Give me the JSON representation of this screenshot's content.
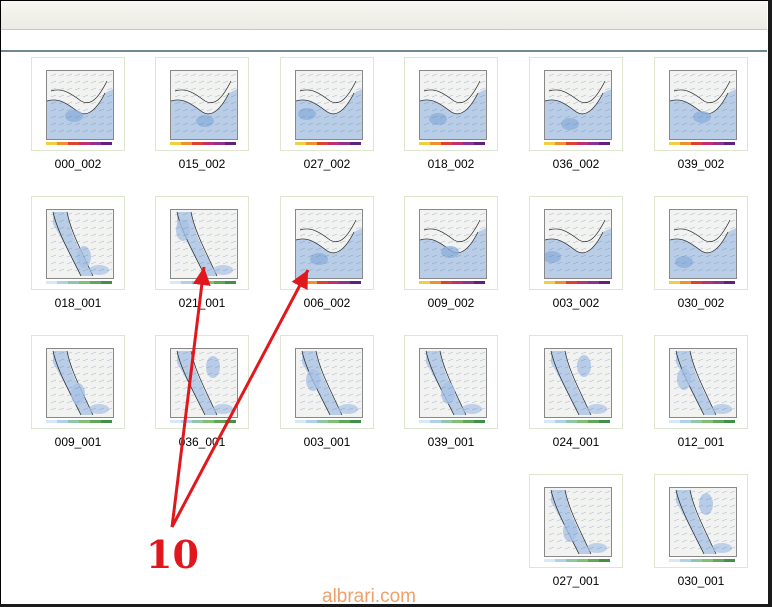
{
  "files": [
    {
      "name": "000_002",
      "kind": "gulf"
    },
    {
      "name": "015_002",
      "kind": "gulf"
    },
    {
      "name": "027_002",
      "kind": "gulf"
    },
    {
      "name": "018_002",
      "kind": "gulf"
    },
    {
      "name": "036_002",
      "kind": "gulf"
    },
    {
      "name": "039_002",
      "kind": "gulf"
    },
    {
      "name": "018_001",
      "kind": "redsea"
    },
    {
      "name": "021_001",
      "kind": "redsea"
    },
    {
      "name": "006_002",
      "kind": "gulf"
    },
    {
      "name": "009_002",
      "kind": "gulf"
    },
    {
      "name": "003_002",
      "kind": "gulf"
    },
    {
      "name": "030_002",
      "kind": "gulf"
    },
    {
      "name": "009_001",
      "kind": "redsea"
    },
    {
      "name": "036_001",
      "kind": "redsea"
    },
    {
      "name": "003_001",
      "kind": "redsea"
    },
    {
      "name": "039_001",
      "kind": "redsea"
    },
    {
      "name": "024_001",
      "kind": "redsea"
    },
    {
      "name": "012_001",
      "kind": "redsea"
    },
    {
      "name": "027_001",
      "kind": "redsea"
    },
    {
      "name": "030_001",
      "kind": "redsea"
    }
  ],
  "annotation": {
    "label": "10",
    "color": "#e0171c"
  },
  "watermark": "albrari.com",
  "colors": {
    "water": "#b9cde6",
    "land": "#f2f2f0",
    "wind": "#3b6ea8",
    "border": "#dfe6cf"
  }
}
